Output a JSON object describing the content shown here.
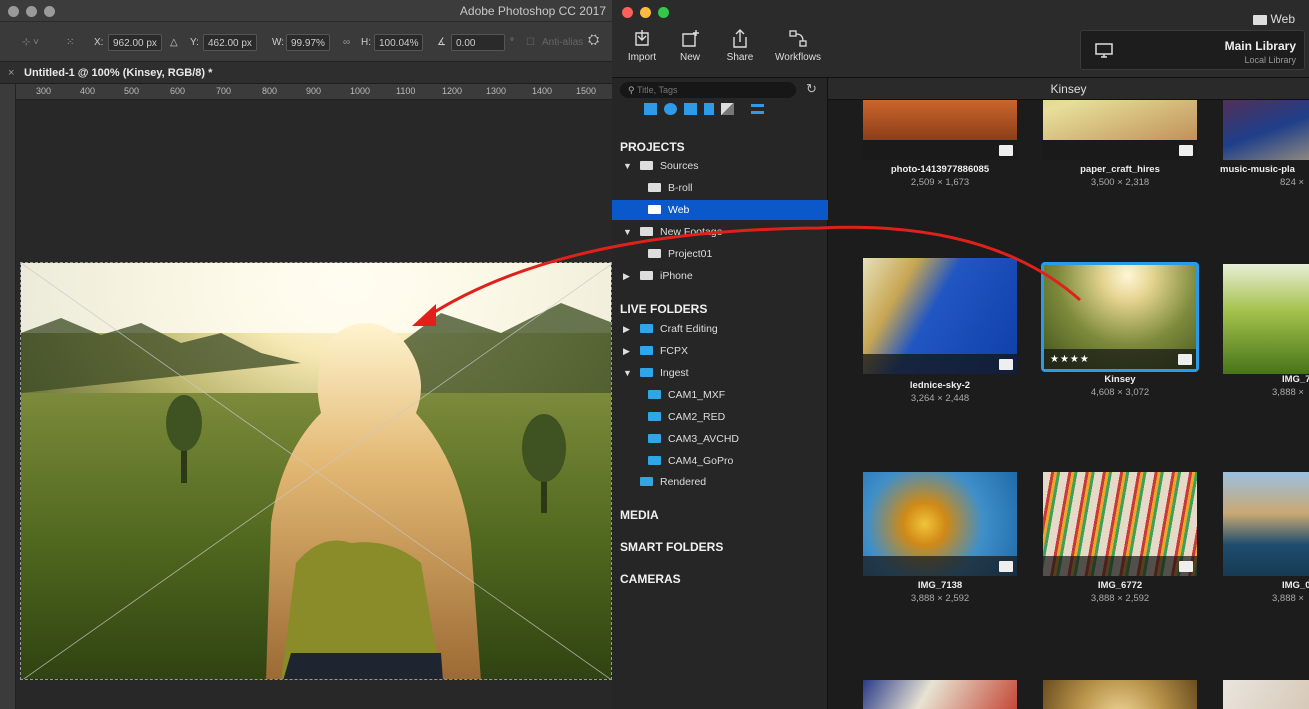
{
  "photoshop": {
    "app_title": "Adobe Photoshop CC 2017",
    "options": {
      "x_label": "X:",
      "x_value": "962.00 px",
      "y_label": "Y:",
      "y_value": "462.00 px",
      "w_label": "W:",
      "w_value": "99.97%",
      "h_label": "H:",
      "h_value": "100.04%",
      "angle_value": "0.00",
      "degree_symbol": "°",
      "antialias_label": "Anti-alias"
    },
    "doc_tab": "Untitled-1 @ 100% (Kinsey, RGB/8) *",
    "doc_tab_close": "×",
    "ruler_ticks": [
      "300",
      "400",
      "500",
      "600",
      "700",
      "800",
      "900",
      "1000",
      "1100",
      "1200",
      "1300",
      "1400",
      "1500"
    ]
  },
  "library": {
    "toolbar": [
      {
        "label": "Import",
        "icon": "import-icon"
      },
      {
        "label": "New",
        "icon": "new-icon"
      },
      {
        "label": "Share",
        "icon": "share-icon"
      },
      {
        "label": "Workflows",
        "icon": "workflows-icon"
      }
    ],
    "current_folder": "Web",
    "library_title": "Main Library",
    "library_subtitle": "Local Library",
    "search_placeholder": "Title, Tags",
    "grid_title": "Kinsey",
    "sections": {
      "projects": "PROJECTS",
      "live_folders": "LIVE FOLDERS",
      "media": "MEDIA",
      "smart_folders": "SMART FOLDERS",
      "cameras": "CAMERAS"
    },
    "projects": {
      "sources": "Sources",
      "broll": "B-roll",
      "web": "Web",
      "new_footage": "New Footage",
      "project01": "Project01",
      "iphone": "iPhone"
    },
    "live": {
      "craft": "Craft Editing",
      "fcpx": "FCPX",
      "ingest": "Ingest",
      "cam1": "CAM1_MXF",
      "cam2": "CAM2_RED",
      "cam3": "CAM3_AVCHD",
      "cam4": "CAM4_GoPro",
      "rendered": "Rendered"
    },
    "thumbs": [
      {
        "name": "photo-1413977886085",
        "dims": "2,509 × 1,673"
      },
      {
        "name": "paper_craft_hires",
        "dims": "3,500 × 2,318"
      },
      {
        "name": "music-music-pla",
        "dims": "824 ×"
      },
      {
        "name": "lednice-sky-2",
        "dims": "3,264 × 2,448"
      },
      {
        "name": "Kinsey",
        "dims": "4,608 × 3,072",
        "stars": "★★★★"
      },
      {
        "name": "IMG_7",
        "dims": "3,888 ×"
      },
      {
        "name": "IMG_7138",
        "dims": "3,888 × 2,592"
      },
      {
        "name": "IMG_6772",
        "dims": "3,888 × 2,592"
      },
      {
        "name": "IMG_0",
        "dims": "3,888 ×"
      }
    ],
    "accent": "#0a58c9",
    "folder_color": "#2fa6e8",
    "arrow_color": "#e0211b"
  }
}
